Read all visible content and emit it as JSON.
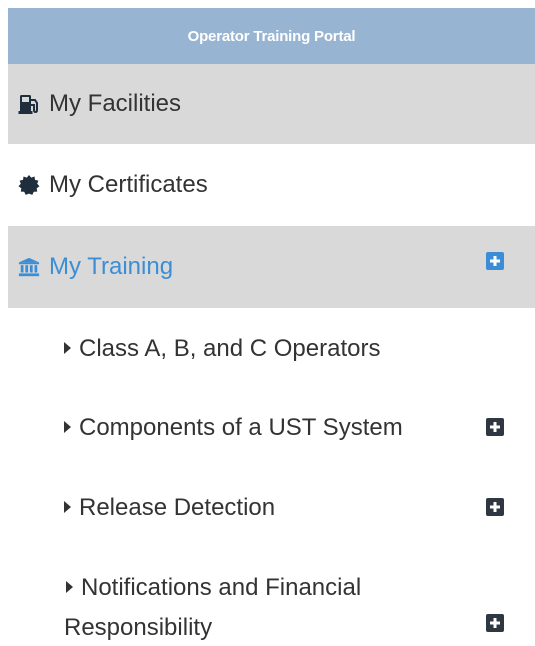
{
  "header": {
    "title": "Operator Training Portal"
  },
  "nav": {
    "facilities": {
      "label": "My Facilities",
      "icon": "gas-pump-icon"
    },
    "certificates": {
      "label": "My Certificates",
      "icon": "certificate-icon"
    },
    "training": {
      "label": "My Training",
      "icon": "institution-icon",
      "expand_icon": "plus-square-icon"
    }
  },
  "training_items": [
    {
      "label": "Class A, B, and C Operators",
      "expandable": false
    },
    {
      "label": "Components of a UST System",
      "expandable": true
    },
    {
      "label": "Release Detection",
      "expandable": true
    },
    {
      "label_line1": "Notifications and Financial",
      "label_line2": "Responsibility",
      "expandable": true
    }
  ],
  "colors": {
    "header_bg": "#98b4d3",
    "active_text": "#3b8ed6",
    "row_bg": "#d9d9d9",
    "expand_dark": "#2e3742"
  }
}
